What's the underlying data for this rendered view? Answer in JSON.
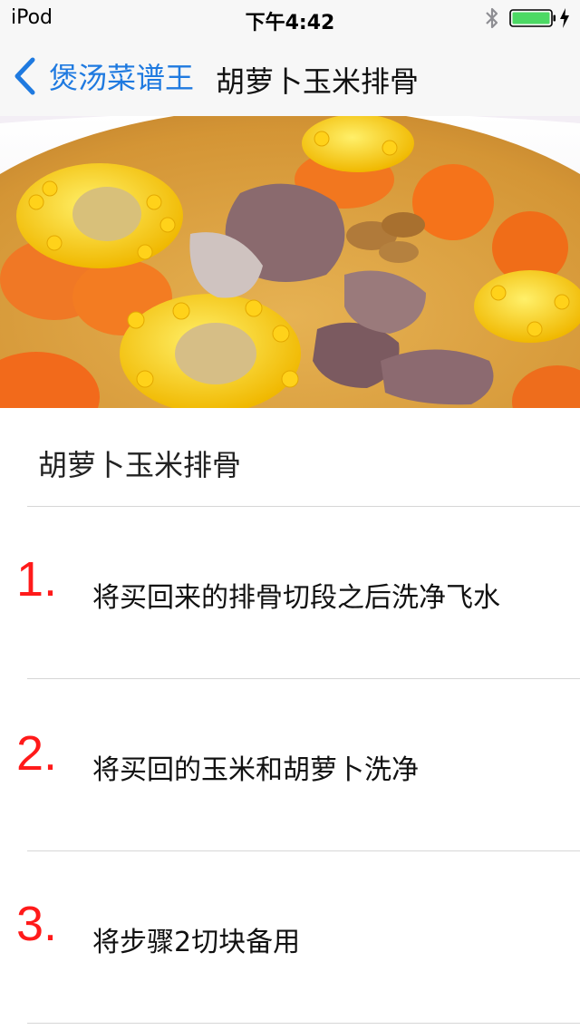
{
  "status_bar": {
    "carrier": "iPod",
    "time": "下午4:42",
    "battery_color": "#4cd964"
  },
  "nav": {
    "back_label": "煲汤菜谱王",
    "title": "胡萝卜玉米排骨",
    "accent_color": "#1f7ae0"
  },
  "recipe": {
    "title": "胡萝卜玉米排骨",
    "steps": [
      {
        "number": "1.",
        "text": "将买回来的排骨切段之后洗净飞水"
      },
      {
        "number": "2.",
        "text": "将买回的玉米和胡萝卜洗净"
      },
      {
        "number": "3.",
        "text": "将步骤2切块备用"
      }
    ],
    "step_number_color": "#ff1a1a"
  }
}
